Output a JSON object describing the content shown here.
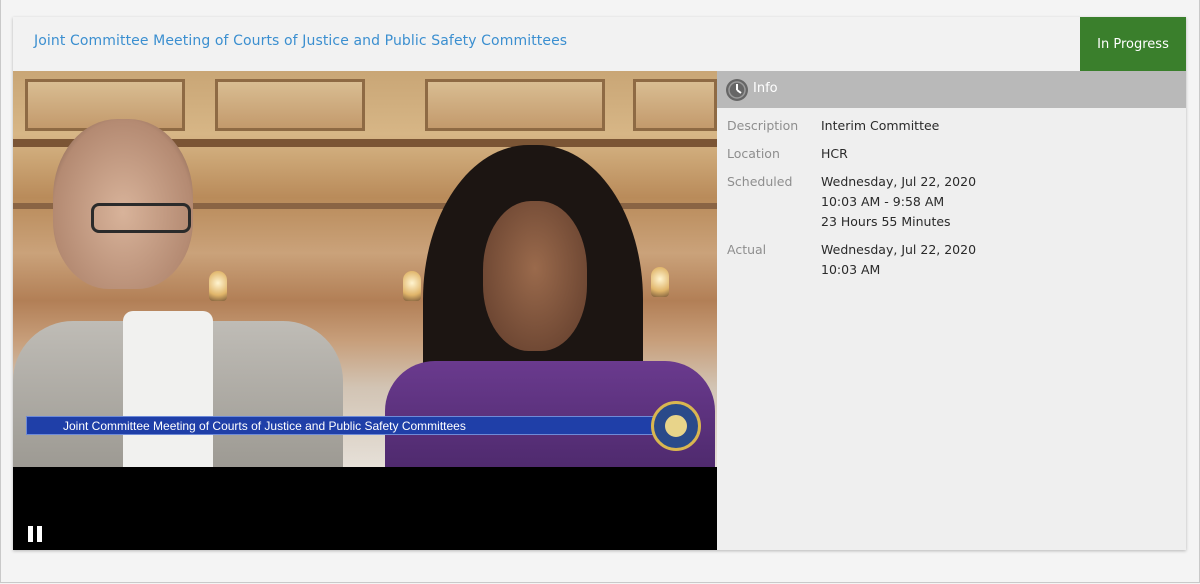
{
  "meeting": {
    "title": "Joint Committee Meeting of Courts of Justice and Public Safety Committees",
    "status": "In Progress",
    "status_color": "#3a7f2c",
    "title_color": "#3b8fd0"
  },
  "video": {
    "caption": "Joint Committee Meeting of Courts of Justice and Public Safety Committees",
    "control": "pause-icon"
  },
  "info": {
    "header": "Info",
    "icon": "clock-icon",
    "description_label": "Description",
    "description_value": "Interim Committee",
    "location_label": "Location",
    "location_value": "HCR",
    "scheduled_label": "Scheduled",
    "scheduled_date": "Wednesday, Jul 22, 2020",
    "scheduled_time": "10:03 AM - 9:58 AM",
    "scheduled_duration": "23 Hours 55 Minutes",
    "actual_label": "Actual",
    "actual_date": "Wednesday, Jul 22, 2020",
    "actual_time": "10:03 AM"
  }
}
